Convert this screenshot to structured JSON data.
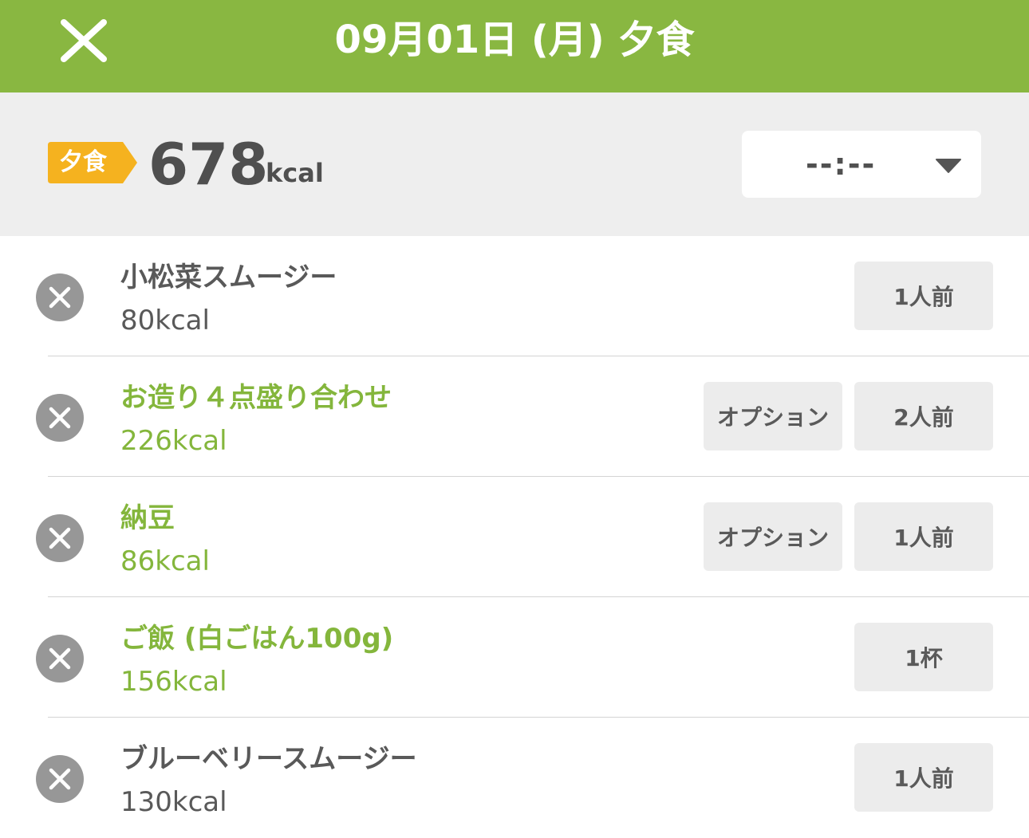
{
  "header": {
    "title": "09月01日 (月) 夕食",
    "background": "#89b741",
    "close_icon": "close-icon"
  },
  "summary": {
    "meal_label": "夕食",
    "badge_color": "#f5b21f",
    "total_kcal": "678",
    "kcal_unit": "kcal",
    "time_value": "--:--",
    "dropdown_icon": "chevron-down-icon"
  },
  "items": [
    {
      "name": "小松菜スムージー",
      "kcal": "80kcal",
      "option": null,
      "portion": "1人前",
      "style": "gray"
    },
    {
      "name": "お造り４点盛り合わせ",
      "kcal": "226kcal",
      "option": "オプション",
      "portion": "2人前",
      "style": "green"
    },
    {
      "name": "納豆",
      "kcal": "86kcal",
      "option": "オプション",
      "portion": "1人前",
      "style": "green"
    },
    {
      "name": "ご飯 (白ごはん100g)",
      "kcal": "156kcal",
      "option": null,
      "portion": "1杯",
      "style": "green"
    },
    {
      "name": "ブルーベリースムージー",
      "kcal": "130kcal",
      "option": null,
      "portion": "1人前",
      "style": "gray"
    }
  ],
  "colors": {
    "accent_green": "#84b63c",
    "text_gray": "#595959",
    "pill_bg": "#ececec",
    "remove_icon_bg": "#979797"
  }
}
